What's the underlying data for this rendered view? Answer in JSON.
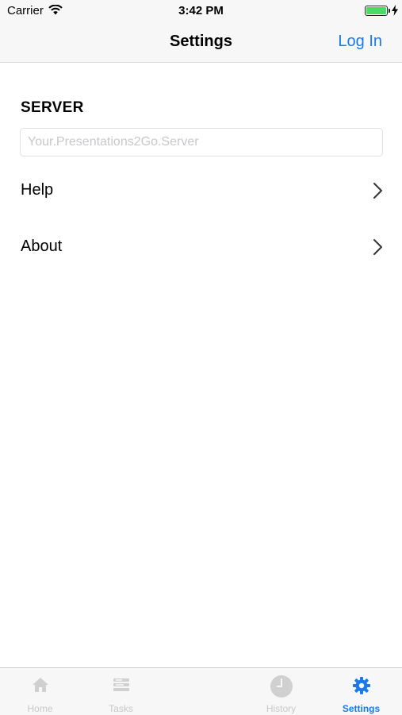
{
  "status_bar": {
    "carrier": "Carrier",
    "time": "3:42 PM",
    "battery_color": "#4cd964"
  },
  "nav": {
    "title": "Settings",
    "login_label": "Log In",
    "accent_color": "#1a7ae9"
  },
  "server": {
    "header": "SERVER",
    "value": "",
    "placeholder": "Your.Presentations2Go.Server"
  },
  "menu": {
    "items": [
      {
        "label": "Help",
        "icon": "chevron-right-icon"
      },
      {
        "label": "About",
        "icon": "chevron-right-icon"
      }
    ]
  },
  "tabs": {
    "items": [
      {
        "label": "Home",
        "icon": "home-icon",
        "active": false
      },
      {
        "label": "Tasks",
        "icon": "tasks-icon",
        "active": false
      },
      {
        "label": "History",
        "icon": "clock-icon",
        "active": false
      },
      {
        "label": "Settings",
        "icon": "gear-icon",
        "active": true
      }
    ]
  }
}
